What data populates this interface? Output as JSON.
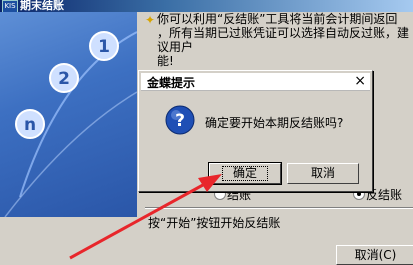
{
  "window": {
    "icon_text": "KIS",
    "title": "期末结账"
  },
  "info": {
    "text": "你可以利用“反结账”工具将当前会计期间返回\n，所有当期已过账凭证可以选择自动反过账，建议用户\n能!"
  },
  "side_panel": {
    "numbers": [
      "1",
      "2",
      "n"
    ]
  },
  "options": {
    "close_label": "结账",
    "reverse_label": "反结账",
    "selected": "反结账"
  },
  "hint": "按“开始”按钮开始反结账",
  "bottom_button": "取消(C)",
  "dialog": {
    "title": "金蝶提示",
    "close_glyph": "×",
    "message": "确定要开始本期反结账吗?",
    "ok_label": "确定",
    "cancel_label": "取消"
  },
  "colors": {
    "arrow": "#e8262b",
    "titlebar": "#0a246a",
    "side_panel": "#3d70c2"
  }
}
